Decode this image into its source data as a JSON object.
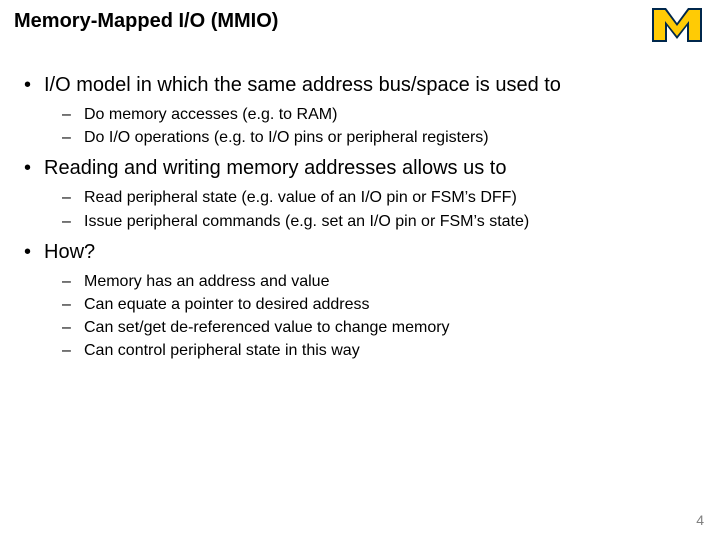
{
  "title": "Memory-Mapped I/O (MMIO)",
  "logo": {
    "name": "michigan-logo",
    "color_main": "#00274c",
    "color_accent": "#ffcb05"
  },
  "bullets": [
    {
      "text": "I/O model in which the same address bus/space is used to",
      "sub": [
        "Do memory accesses (e.g. to RAM)",
        "Do I/O operations (e.g. to I/O pins or peripheral registers)"
      ]
    },
    {
      "text": "Reading and writing memory addresses allows us to",
      "sub": [
        "Read peripheral state (e.g. value of an I/O pin or FSM’s DFF)",
        "Issue peripheral commands (e.g. set an I/O pin or FSM’s state)"
      ]
    },
    {
      "text": "How?",
      "sub": [
        "Memory has an address and value",
        "Can equate a pointer to desired address",
        "Can set/get de-referenced value to change memory",
        "Can control peripheral state in this way"
      ]
    }
  ],
  "page_number": "4"
}
